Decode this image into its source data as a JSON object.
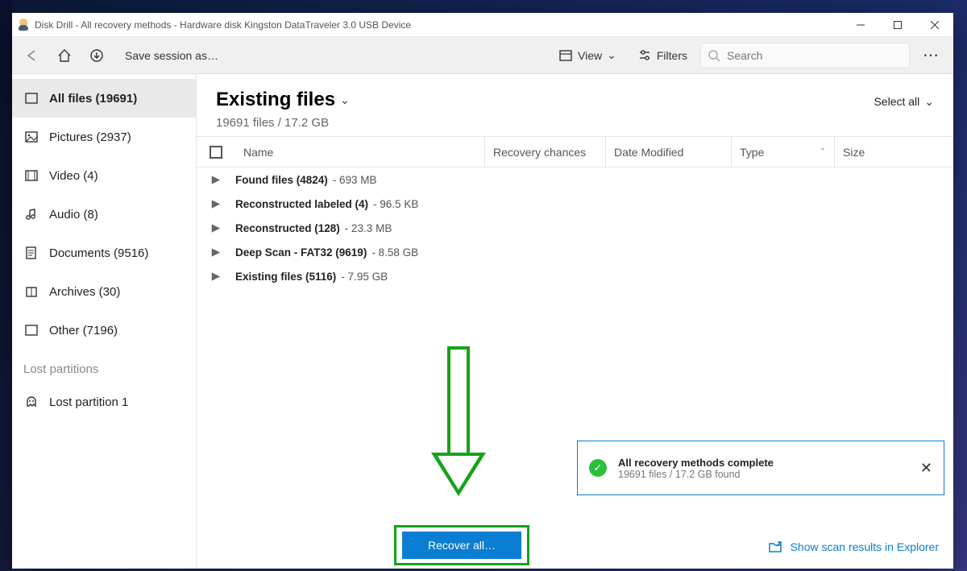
{
  "window": {
    "title": "Disk Drill - All recovery methods - Hardware disk Kingston DataTraveler 3.0 USB Device"
  },
  "toolbar": {
    "save_label": "Save session as…",
    "view_label": "View",
    "filters_label": "Filters",
    "search_placeholder": "Search"
  },
  "sidebar": {
    "items": [
      {
        "label": "All files (19691)"
      },
      {
        "label": "Pictures (2937)"
      },
      {
        "label": "Video (4)"
      },
      {
        "label": "Audio (8)"
      },
      {
        "label": "Documents (9516)"
      },
      {
        "label": "Archives (30)"
      },
      {
        "label": "Other (7196)"
      }
    ],
    "lost_header": "Lost partitions",
    "lost_items": [
      {
        "label": "Lost partition 1"
      }
    ]
  },
  "main": {
    "title": "Existing files",
    "subtitle": "19691 files / 17.2 GB",
    "select_all_label": "Select all",
    "columns": {
      "name": "Name",
      "chances": "Recovery chances",
      "date": "Date Modified",
      "type": "Type",
      "size": "Size"
    },
    "rows": [
      {
        "name": "Found files (4824)",
        "detail": "- 693 MB"
      },
      {
        "name": "Reconstructed labeled (4)",
        "detail": "- 96.5 KB"
      },
      {
        "name": "Reconstructed (128)",
        "detail": "- 23.3 MB"
      },
      {
        "name": "Deep Scan - FAT32 (9619)",
        "detail": "- 8.58 GB"
      },
      {
        "name": "Existing files (5116)",
        "detail": "- 7.95 GB"
      }
    ]
  },
  "notice": {
    "title": "All recovery methods complete",
    "subtitle": "19691 files / 17.2 GB found"
  },
  "actions": {
    "recover_all": "Recover all…",
    "show_in_explorer": "Show scan results in Explorer"
  }
}
